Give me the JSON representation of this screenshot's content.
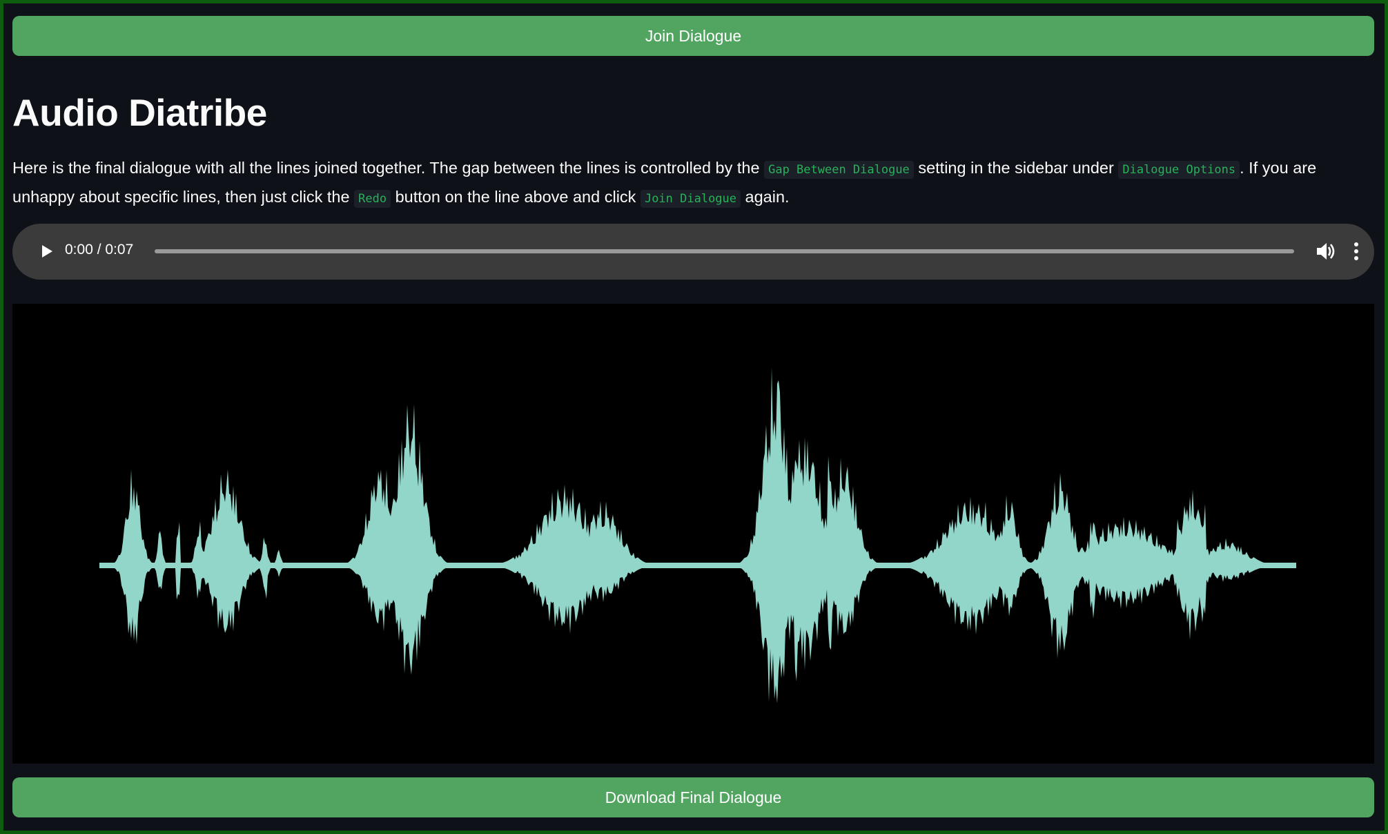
{
  "buttons": {
    "join": "Join Dialogue",
    "download": "Download Final Dialogue"
  },
  "page": {
    "title": "Audio Diatribe",
    "description": {
      "t1": "Here is the final dialogue with all the lines joined together. The gap between the lines is controlled by the ",
      "c1": "Gap Between Dialogue",
      "t2": " setting in the sidebar under ",
      "c2": "Dialogue Options",
      "t3": ". If you are unhappy about specific lines, then just click the ",
      "c3": "Redo",
      "t4": " button on the line above and click ",
      "c4": "Join Dialogue",
      "t5": " again."
    }
  },
  "player": {
    "time": "0:00 / 0:07",
    "progress": 0
  },
  "waveform": {
    "color": "#92d5c9",
    "background": "#000000"
  },
  "colors": {
    "button": "#52a561",
    "code": "#26b35a",
    "page_bg": "#0e1117",
    "frame": "#0e5c0e"
  }
}
